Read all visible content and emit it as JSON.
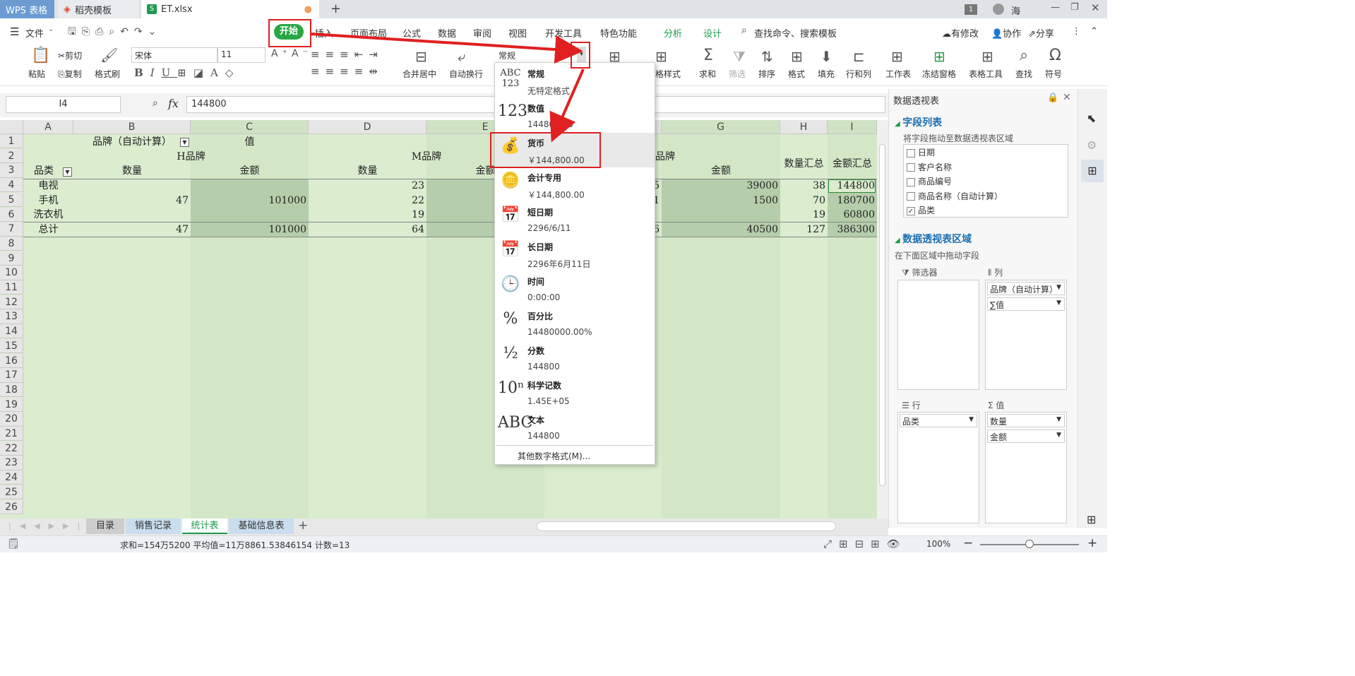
{
  "tabs": {
    "app": "WPS 表格",
    "docer": "稻壳模板",
    "file": "ET.xlsx",
    "user": "海",
    "badge": "1"
  },
  "menu": {
    "file": "文件",
    "items": [
      "开始",
      "插入",
      "页面布局",
      "公式",
      "数据",
      "审阅",
      "视图",
      "开发工具",
      "特色功能",
      "分析",
      "设计"
    ],
    "search": "查找命令、搜索模板",
    "modified": "有修改",
    "collab": "协作",
    "share": "分享"
  },
  "ribbon": {
    "paste": "粘贴",
    "cut": "剪切",
    "copy": "复制",
    "format_painter": "格式刷",
    "font": "宋体",
    "size": "11",
    "merge": "合并居中",
    "wrap": "自动换行",
    "numfmt": "常规",
    "cond_fmt": "格样式",
    "sum": "求和",
    "filter": "筛选",
    "sort": "排序",
    "format": "格式",
    "fill": "填充",
    "rowcol": "行和列",
    "sheet": "工作表",
    "freeze": "冻结窗格",
    "tabletool": "表格工具",
    "find": "查找",
    "symbol": "符号"
  },
  "formula": {
    "cellref": "I4",
    "fx": "fx",
    "value": "144800"
  },
  "columns": [
    "A",
    "B",
    "C",
    "D",
    "E",
    "F",
    "G",
    "H",
    "I"
  ],
  "rows": [
    "1",
    "2",
    "3",
    "4",
    "5",
    "6",
    "7",
    "8",
    "9",
    "10",
    "11",
    "12",
    "13",
    "14",
    "15",
    "16",
    "17",
    "18",
    "19",
    "20",
    "21",
    "22",
    "23",
    "24",
    "25",
    "26"
  ],
  "cells": {
    "b1": "品牌（自动计算）",
    "c1": "值",
    "hbrand": "H品牌",
    "mbrand": "M品牌",
    "gbrand": "品牌",
    "a3": "品类",
    "b3": "数量",
    "c3": "金额",
    "d3": "数量",
    "e3": "金额",
    "g3": "金额",
    "h23": "数量汇总",
    "i23": "金额汇总",
    "a4": "电视",
    "d4": "23",
    "f4": "5",
    "g4": "39000",
    "h4": "38",
    "i4": "144800",
    "a5": "手机",
    "b5": "47",
    "c5": "101000",
    "d5": "22",
    "f5": "1",
    "g5": "1500",
    "h5": "70",
    "i5": "180700",
    "a6": "洗衣机",
    "d6": "19",
    "h6": "19",
    "i6": "60800",
    "a7": "总计",
    "b7": "47",
    "c7": "101000",
    "d7": "64",
    "f7": "6",
    "g7": "40500",
    "h7": "127",
    "i7": "386300"
  },
  "dropdown": [
    {
      "title": "常规",
      "sub": "无特定格式",
      "icon": "ABC\n123"
    },
    {
      "title": "数值",
      "sub": "144800.00",
      "icon": "123"
    },
    {
      "title": "货币",
      "sub": "￥144,800.00",
      "icon": "💰"
    },
    {
      "title": "会计专用",
      "sub": "￥144,800.00",
      "icon": "🪙"
    },
    {
      "title": "短日期",
      "sub": "2296/6/11",
      "icon": "📅"
    },
    {
      "title": "长日期",
      "sub": "2296年6月11日",
      "icon": "📅"
    },
    {
      "title": "时间",
      "sub": "0:00:00",
      "icon": "🕒"
    },
    {
      "title": "百分比",
      "sub": "14480000.00%",
      "icon": "%"
    },
    {
      "title": "分数",
      "sub": "144800",
      "icon": "½"
    },
    {
      "title": "科学记数",
      "sub": "1.45E+05",
      "icon": "10ⁿ"
    },
    {
      "title": "文本",
      "sub": "144800",
      "icon": "ABC"
    }
  ],
  "dropdown_more": "其他数字格式(M)...",
  "panel": {
    "title": "数据透视表",
    "fieldlist": "字段列表",
    "hint1": "将字段拖动至数据透视表区域",
    "fields": [
      "日期",
      "客户名称",
      "商品编号",
      "商品名称（自动计算）",
      "品类"
    ],
    "area": "数据透视表区域",
    "hint2": "在下面区域中拖动字段",
    "filter": "筛选器",
    "col": "列",
    "row": "行",
    "val": "值",
    "col_items": [
      "品牌（自动计算）",
      "∑值"
    ],
    "row_items": [
      "品类"
    ],
    "val_items": [
      "数量",
      "金额"
    ]
  },
  "sheets": [
    "目录",
    "销售记录",
    "统计表",
    "基础信息表"
  ],
  "status": {
    "text": "求和=154万5200  平均值=11万8861.53846154  计数=13",
    "zoom": "100%"
  }
}
